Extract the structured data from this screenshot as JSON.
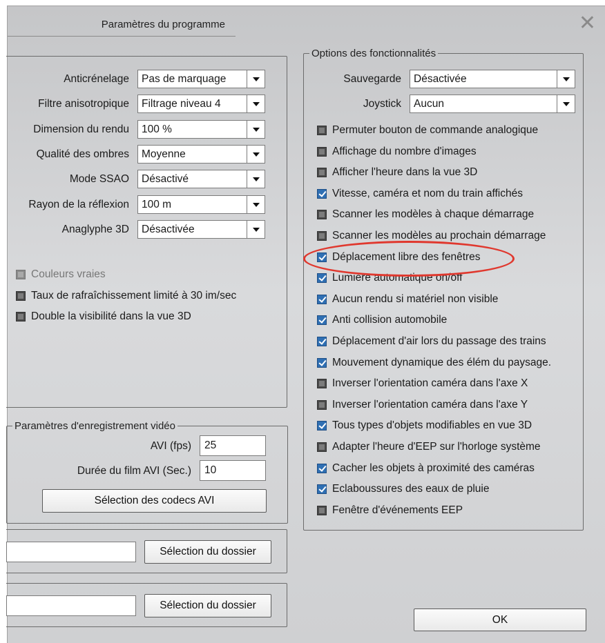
{
  "window": {
    "title": "Paramètres du programme"
  },
  "graphics": [
    {
      "label": "Anticrénelage",
      "value": "Pas de marquage"
    },
    {
      "label": "Filtre anisotropique",
      "value": "Filtrage niveau 4"
    },
    {
      "label": "Dimension du rendu",
      "value": "100 %"
    },
    {
      "label": "Qualité des ombres",
      "value": "Moyenne"
    },
    {
      "label": "Mode SSAO",
      "value": "Désactivé"
    },
    {
      "label": "Rayon de la réflexion",
      "value": "100 m"
    },
    {
      "label": "Anaglyphe 3D",
      "value": "Désactivée"
    }
  ],
  "left_checkboxes": [
    {
      "label": "Couleurs vraies",
      "checked": false,
      "disabled": true
    },
    {
      "label": "Taux de rafraîchissement limité à 30 im/sec",
      "checked": false,
      "disabled": false
    },
    {
      "label": "Double la visibilité dans la vue 3D",
      "checked": false,
      "disabled": false
    }
  ],
  "video": {
    "legend": "Paramètres d'enregistrement vidéo",
    "fps_label": "AVI (fps)",
    "fps_value": "25",
    "duration_label": "Durée du film AVI (Sec.)",
    "duration_value": "10",
    "codecs_button": "Sélection des codecs AVI"
  },
  "folders": [
    {
      "value": "",
      "button": "Sélection du dossier"
    },
    {
      "value": "",
      "button": "Sélection du dossier"
    }
  ],
  "options": {
    "legend": "Options des fonctionnalités",
    "sauvegarde_label": "Sauvegarde",
    "sauvegarde_value": "Désactivée",
    "joystick_label": "Joystick",
    "joystick_value": "Aucun",
    "items": [
      {
        "label": "Permuter bouton de commande analogique",
        "checked": false
      },
      {
        "label": "Affichage du nombre d'images",
        "checked": false
      },
      {
        "label": "Afficher l'heure dans la vue 3D",
        "checked": false
      },
      {
        "label": "Vitesse, caméra et nom du train affichés",
        "checked": true
      },
      {
        "label": "Scanner les modèles à chaque démarrage",
        "checked": false
      },
      {
        "label": "Scanner les modèles au prochain démarrage",
        "checked": false
      },
      {
        "label": "Déplacement libre des fenêtres",
        "checked": true
      },
      {
        "label": "Lumière automatique on/off",
        "checked": true
      },
      {
        "label": "Aucun rendu si matériel non visible",
        "checked": true
      },
      {
        "label": "Anti collision automobile",
        "checked": true
      },
      {
        "label": "Déplacement d'air lors du passage des trains",
        "checked": true
      },
      {
        "label": "Mouvement dynamique des élém du paysage.",
        "checked": true
      },
      {
        "label": "Inverser l'orientation caméra dans l'axe X",
        "checked": false
      },
      {
        "label": "Inverser l'orientation caméra dans l'axe Y",
        "checked": false
      },
      {
        "label": "Tous types d'objets modifiables en vue 3D",
        "checked": true
      },
      {
        "label": "Adapter l'heure d'EEP sur l'horloge système",
        "checked": false
      },
      {
        "label": "Cacher les objets à proximité des caméras",
        "checked": true
      },
      {
        "label": "Eclaboussures des eaux de pluie",
        "checked": true
      },
      {
        "label": "Fenêtre d'événements EEP",
        "checked": false
      }
    ]
  },
  "ok_button": "OK",
  "annotation_color": "#e0382e",
  "icons": {
    "close": "close-icon",
    "dropdown": "chevron-down-icon"
  }
}
